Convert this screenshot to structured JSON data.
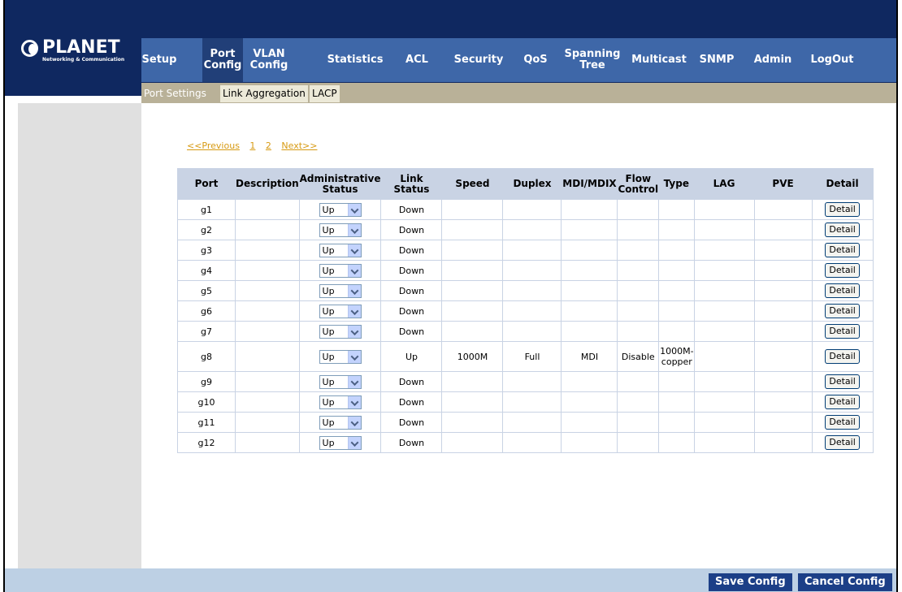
{
  "brand": {
    "name": "PLANET",
    "tagline": "Networking & Communication"
  },
  "nav": [
    {
      "label": "Setup"
    },
    {
      "label": "Port\nConfig",
      "active": true
    },
    {
      "label": "VLAN\nConfig"
    },
    {
      "label": "Statistics"
    },
    {
      "label": "ACL"
    },
    {
      "label": "Security"
    },
    {
      "label": "QoS"
    },
    {
      "label": "Spanning\nTree"
    },
    {
      "label": "Multicast"
    },
    {
      "label": "SNMP"
    },
    {
      "label": "Admin"
    },
    {
      "label": "LogOut"
    }
  ],
  "subnav": [
    {
      "label": "Port Settings"
    },
    {
      "label": "Link Aggregation"
    },
    {
      "label": "LACP"
    }
  ],
  "pager": {
    "previous": "<<Previous",
    "page1": "1",
    "page2": "2",
    "next": "Next>>"
  },
  "table": {
    "headers": {
      "port": "Port",
      "description": "Description",
      "admin_status": "Administrative\nStatus",
      "link_status": "Link\nStatus",
      "speed": "Speed",
      "duplex": "Duplex",
      "mdi": "MDI/MDIX",
      "flow": "Flow\nControl",
      "type": "Type",
      "lag": "LAG",
      "pve": "PVE",
      "detail": "Detail"
    },
    "rows": [
      {
        "port": "g1",
        "admin": "Up",
        "link": "Down",
        "speed": "",
        "duplex": "",
        "mdi": "",
        "flow": "",
        "type": "",
        "lag": "",
        "pve": "",
        "detail": "Detail"
      },
      {
        "port": "g2",
        "admin": "Up",
        "link": "Down",
        "speed": "",
        "duplex": "",
        "mdi": "",
        "flow": "",
        "type": "",
        "lag": "",
        "pve": "",
        "detail": "Detail"
      },
      {
        "port": "g3",
        "admin": "Up",
        "link": "Down",
        "speed": "",
        "duplex": "",
        "mdi": "",
        "flow": "",
        "type": "",
        "lag": "",
        "pve": "",
        "detail": "Detail"
      },
      {
        "port": "g4",
        "admin": "Up",
        "link": "Down",
        "speed": "",
        "duplex": "",
        "mdi": "",
        "flow": "",
        "type": "",
        "lag": "",
        "pve": "",
        "detail": "Detail"
      },
      {
        "port": "g5",
        "admin": "Up",
        "link": "Down",
        "speed": "",
        "duplex": "",
        "mdi": "",
        "flow": "",
        "type": "",
        "lag": "",
        "pve": "",
        "detail": "Detail"
      },
      {
        "port": "g6",
        "admin": "Up",
        "link": "Down",
        "speed": "",
        "duplex": "",
        "mdi": "",
        "flow": "",
        "type": "",
        "lag": "",
        "pve": "",
        "detail": "Detail"
      },
      {
        "port": "g7",
        "admin": "Up",
        "link": "Down",
        "speed": "",
        "duplex": "",
        "mdi": "",
        "flow": "",
        "type": "",
        "lag": "",
        "pve": "",
        "detail": "Detail"
      },
      {
        "port": "g8",
        "admin": "Up",
        "link": "Up",
        "speed": "1000M",
        "duplex": "Full",
        "mdi": "MDI",
        "flow": "Disable",
        "type": "1000M-\ncopper",
        "lag": "",
        "pve": "",
        "detail": "Detail"
      },
      {
        "port": "g9",
        "admin": "Up",
        "link": "Down",
        "speed": "",
        "duplex": "",
        "mdi": "",
        "flow": "",
        "type": "",
        "lag": "",
        "pve": "",
        "detail": "Detail"
      },
      {
        "port": "g10",
        "admin": "Up",
        "link": "Down",
        "speed": "",
        "duplex": "",
        "mdi": "",
        "flow": "",
        "type": "",
        "lag": "",
        "pve": "",
        "detail": "Detail"
      },
      {
        "port": "g11",
        "admin": "Up",
        "link": "Down",
        "speed": "",
        "duplex": "",
        "mdi": "",
        "flow": "",
        "type": "",
        "lag": "",
        "pve": "",
        "detail": "Detail"
      },
      {
        "port": "g12",
        "admin": "Up",
        "link": "Down",
        "speed": "",
        "duplex": "",
        "mdi": "",
        "flow": "",
        "type": "",
        "lag": "",
        "pve": "",
        "detail": "Detail"
      }
    ]
  },
  "footer": {
    "save": "Save Config",
    "cancel": "Cancel Config"
  },
  "colors": {
    "header_bg": "#0f2860",
    "nav_bg": "#3e67a8",
    "nav_active": "#213f78",
    "subnav_bg": "#b9b198",
    "table_header": "#c9d3e4",
    "pager_link": "#d79a12",
    "button_bg": "#1c3f87"
  }
}
